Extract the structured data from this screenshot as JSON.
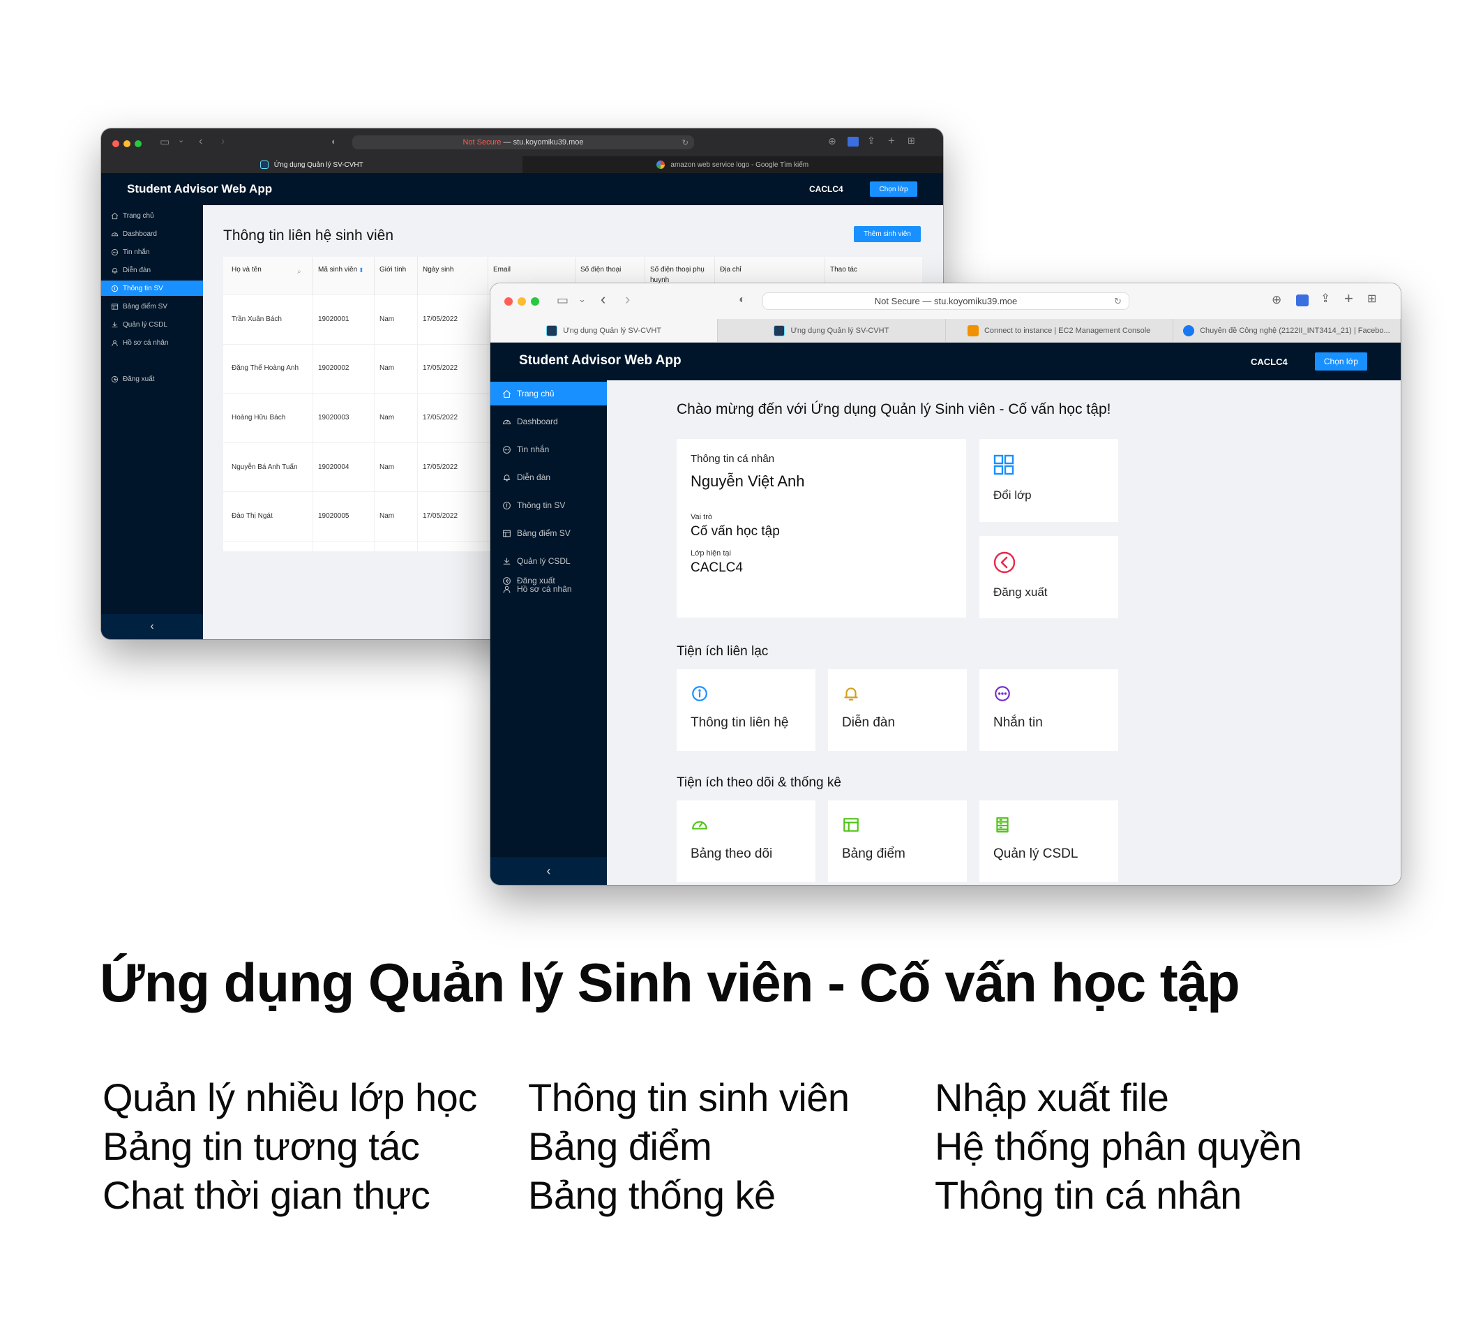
{
  "back_window": {
    "url": {
      "warning": "Not Secure",
      "separator": " — ",
      "host": "stu.koyomiku39.moe"
    },
    "tabs": [
      "Ứng dụng Quản lý SV-CVHT",
      "amazon web service logo - Google Tìm kiếm"
    ],
    "app_title": "Student Advisor Web App",
    "class_code": "CACLC4",
    "choose_class": "Chọn lớp",
    "nav": [
      {
        "label": "Trang chủ",
        "icon": "home-icon"
      },
      {
        "label": "Dashboard",
        "icon": "dashboard-icon"
      },
      {
        "label": "Tin nhắn",
        "icon": "message-icon"
      },
      {
        "label": "Diễn đàn",
        "icon": "bell-icon"
      },
      {
        "label": "Thông tin SV",
        "icon": "info-icon"
      },
      {
        "label": "Bảng điểm SV",
        "icon": "table-icon"
      },
      {
        "label": "Quản lý CSDL",
        "icon": "download-icon"
      },
      {
        "label": "Hồ sơ cá nhân",
        "icon": "user-icon"
      },
      {
        "label": "Đăng xuất",
        "icon": "logout-icon"
      }
    ],
    "active_nav": 4,
    "page_title": "Thông tin liên hệ sinh viên",
    "add_button": "Thêm sinh viên",
    "columns": [
      "Họ và tên",
      "Mã sinh viên",
      "Giới tính",
      "Ngày sinh",
      "Email",
      "Số điện thoại",
      "Số điện thoại phụ huynh",
      "Địa chỉ",
      "Thao tác"
    ],
    "rows": [
      {
        "name": "Trần Xuân Bách",
        "id": "19020001",
        "gender": "Nam",
        "dob": "17/05/2022"
      },
      {
        "name": "Đặng Thế Hoàng Anh",
        "id": "19020002",
        "gender": "Nam",
        "dob": "17/05/2022"
      },
      {
        "name": "Hoàng Hữu Bách",
        "id": "19020003",
        "gender": "Nam",
        "dob": "17/05/2022"
      },
      {
        "name": "Nguyễn Bá Anh Tuấn",
        "id": "19020004",
        "gender": "Nam",
        "dob": "17/05/2022"
      },
      {
        "name": "Đào Thị Ngát",
        "id": "19020005",
        "gender": "Nam",
        "dob": "17/05/2022"
      }
    ],
    "collapse": "‹"
  },
  "front_window": {
    "url": "Not Secure — stu.koyomiku39.moe",
    "tabs": [
      {
        "label": "Ứng dụng Quản lý SV-CVHT",
        "icon": "react-icon"
      },
      {
        "label": "Ứng dụng Quản lý SV-CVHT",
        "icon": "react-icon"
      },
      {
        "label": "Connect to instance | EC2 Management Console",
        "icon": "aws-icon"
      },
      {
        "label": "Chuyên đề Công nghệ (2122II_INT3414_21) | Facebo...",
        "icon": "facebook-icon"
      }
    ],
    "app_title": "Student Advisor Web App",
    "class_code": "CACLC4",
    "choose_class": "Chọn lớp",
    "nav": [
      {
        "label": "Trang chủ",
        "icon": "home-icon"
      },
      {
        "label": "Dashboard",
        "icon": "dashboard-icon"
      },
      {
        "label": "Tin nhắn",
        "icon": "message-icon"
      },
      {
        "label": "Diễn đàn",
        "icon": "bell-icon"
      },
      {
        "label": "Thông tin SV",
        "icon": "info-icon"
      },
      {
        "label": "Bảng điểm SV",
        "icon": "table-icon"
      },
      {
        "label": "Quản lý CSDL",
        "icon": "download-icon"
      },
      {
        "label": "Hồ sơ cá nhân",
        "icon": "user-icon"
      },
      {
        "label": "Đăng xuất",
        "icon": "logout-icon"
      }
    ],
    "active_nav": 0,
    "welcome": "Chào mừng đến với Ứng dụng Quản lý Sinh viên - Cố vấn học tập!",
    "profile": {
      "heading": "Thông tin cá nhân",
      "name": "Nguyễn Việt Anh",
      "role_label": "Vai trò",
      "role": "Cố vấn học tập",
      "class_label": "Lớp hiện tại",
      "class_value": "CACLC4"
    },
    "switch_class": "Đổi lớp",
    "logout": "Đăng xuất",
    "section_contact": "Tiện ích liên lạc",
    "contact_tiles": [
      {
        "label": "Thông tin liên hệ",
        "icon": "info-icon",
        "color": "#1890ff"
      },
      {
        "label": "Diễn đàn",
        "icon": "bell-icon",
        "color": "#d4a017"
      },
      {
        "label": "Nhắn tin",
        "icon": "message-icon",
        "color": "#722ed1"
      }
    ],
    "section_stats": "Tiện ích theo dõi & thống kê",
    "stats_tiles": [
      {
        "label": "Bảng theo dõi",
        "icon": "dashboard-icon",
        "color": "#52c41a"
      },
      {
        "label": "Bảng điểm",
        "icon": "table-icon",
        "color": "#52c41a"
      },
      {
        "label": "Quản lý CSDL",
        "icon": "database-icon",
        "color": "#52c41a"
      }
    ],
    "collapse": "‹"
  },
  "headline": "Ứng dụng Quản lý Sinh viên - Cố vấn học tập",
  "features": [
    [
      "Quản lý nhiều lớp học",
      "Bảng tin tương tác",
      "Chat thời gian thực"
    ],
    [
      "Thông tin sinh viên",
      "Bảng điểm",
      "Bảng thống kê"
    ],
    [
      "Nhập xuất file",
      "Hệ thống phân quyền",
      "Thông tin cá nhân"
    ]
  ],
  "colors": {
    "primary": "#1890ff",
    "sider": "#001529",
    "content_bg": "#f0f2f5",
    "danger": "#e8284a"
  }
}
